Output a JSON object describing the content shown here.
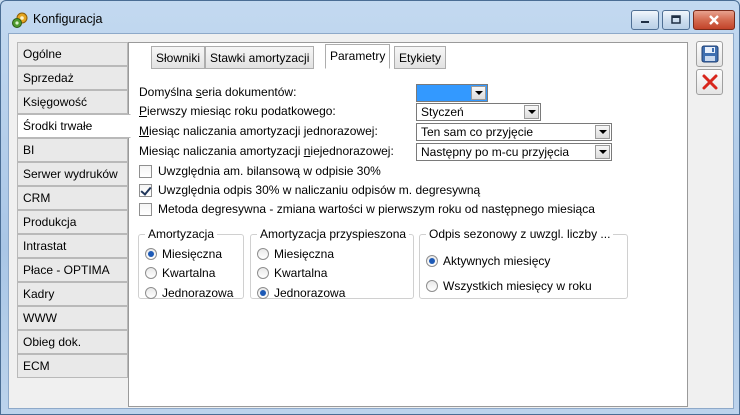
{
  "window": {
    "title": "Konfiguracja"
  },
  "sidebar": {
    "items": [
      {
        "label": "Ogólne"
      },
      {
        "label": "Sprzedaż"
      },
      {
        "label": "Księgowość"
      },
      {
        "label": "Środki trwałe",
        "active": true
      },
      {
        "label": "BI"
      },
      {
        "label": "Serwer wydruków"
      },
      {
        "label": "CRM"
      },
      {
        "label": "Produkcja"
      },
      {
        "label": "Intrastat"
      },
      {
        "label": "Płace - OPTIMA"
      },
      {
        "label": "Kadry"
      },
      {
        "label": "WWW"
      },
      {
        "label": "Obieg dok."
      },
      {
        "label": "ECM"
      }
    ]
  },
  "tabs": [
    {
      "label": "Słowniki"
    },
    {
      "label": "Stawki amortyzacji"
    },
    {
      "label": "Parametry",
      "active": true
    },
    {
      "label": "Etykiety"
    }
  ],
  "form": {
    "seria": {
      "label_pre": "Domyślna ",
      "label_u": "s",
      "label_post": "eria dokumentów:",
      "value": ""
    },
    "pierwszy": {
      "label_pre": "",
      "label_u": "P",
      "label_post": "ierwszy miesiąc roku podatkowego:",
      "value": "Styczeń"
    },
    "jednorazowej": {
      "label_pre": "",
      "label_u": "M",
      "label_post": "iesiąc naliczania amortyzacji jednorazowej:",
      "value": "Ten sam co przyjęcie"
    },
    "niejednorazowej": {
      "label_pre": "Miesiąc naliczania amortyzacji ",
      "label_u": "n",
      "label_post": "iejednorazowej:",
      "value": "Następny po m-cu przyjęcia"
    }
  },
  "checkboxes": [
    {
      "label": "Uwzględnia am. bilansową w odpisie 30%",
      "checked": false
    },
    {
      "label": "Uwzględnia odpis 30% w naliczaniu odpisów m. degresywną",
      "checked": true
    },
    {
      "label": "Metoda degresywna - zmiana wartości w pierwszym roku od następnego miesiąca",
      "checked": false
    }
  ],
  "groups": {
    "amortyzacja": {
      "title": "Amortyzacja",
      "options": [
        {
          "label": "Miesięczna",
          "selected": true
        },
        {
          "label": "Kwartalna",
          "selected": false
        },
        {
          "label": "Jednorazowa",
          "selected": false
        }
      ]
    },
    "przyspieszona": {
      "title": "Amortyzacja przyspieszona",
      "options": [
        {
          "label": "Miesięczna",
          "selected": false
        },
        {
          "label": "Kwartalna",
          "selected": false
        },
        {
          "label": "Jednorazowa",
          "selected": true
        }
      ]
    },
    "sezonowy": {
      "title": "Odpis sezonowy z uwzgl. liczby ...",
      "options": [
        {
          "label": "Aktywnych miesięcy",
          "selected": true
        },
        {
          "label": "Wszystkich miesięcy w roku",
          "selected": false
        }
      ]
    }
  },
  "colors": {
    "save": "#3f6fb0",
    "cancel": "#d8261c",
    "selected_combo": "#3399ff"
  }
}
